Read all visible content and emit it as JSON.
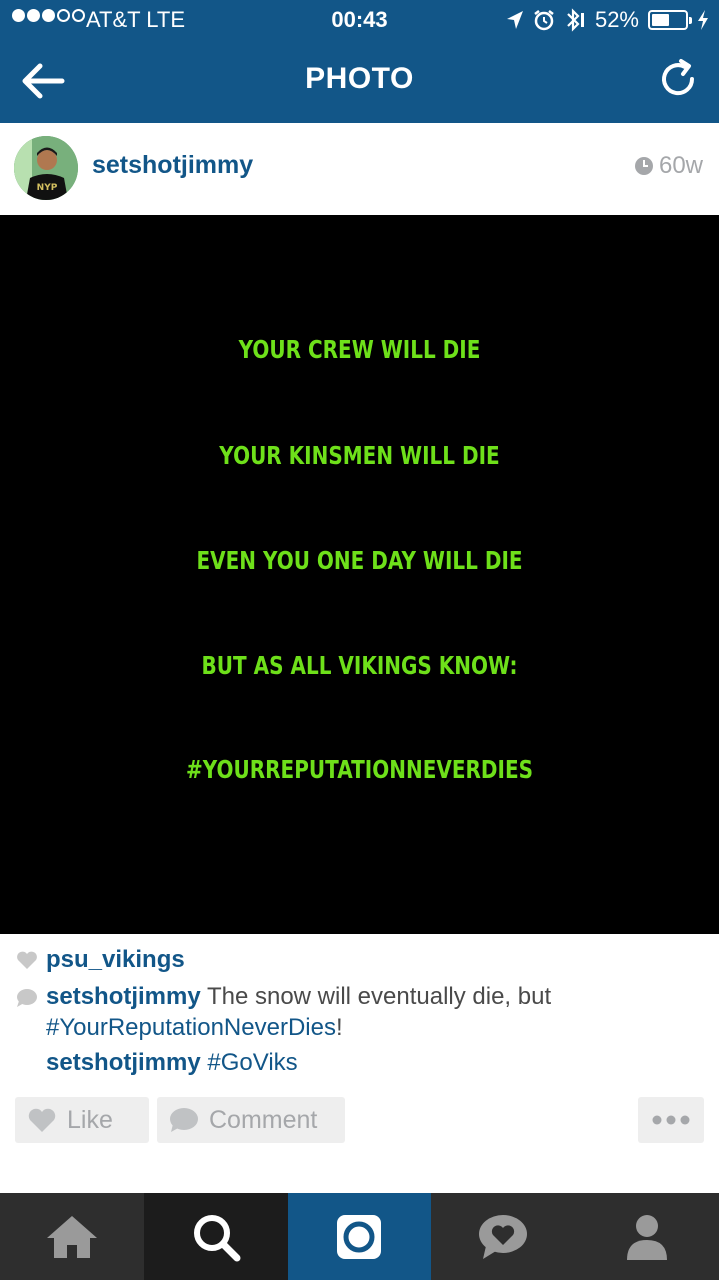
{
  "status_bar": {
    "carrier": "AT&T  LTE",
    "time": "00:43",
    "battery": "52%",
    "battery_level": 0.52
  },
  "nav": {
    "title": "PHOTO"
  },
  "post": {
    "username": "setshotjimmy",
    "age": "60w",
    "photo_text": [
      "YOUR CREW WILL DIE",
      "YOUR KINSMEN WILL DIE",
      "EVEN YOU ONE DAY WILL DIE",
      "BUT AS ALL VIKINGS KNOW:",
      "#YOURREPUTATIONNEVERDIES"
    ],
    "likes": "psu_vikings",
    "caption_user": "setshotjimmy",
    "caption_text": " The snow will eventually die, but",
    "caption_hashtag": "#YourReputationNeverDies",
    "caption_end": "!",
    "comment_user": "setshotjimmy",
    "comment_hashtag": " #GoViks"
  },
  "actions": {
    "like_label": "Like",
    "comment_label": "Comment"
  },
  "colors": {
    "brand_blue": "#125688",
    "photo_text_green": "#6ee01a",
    "tabbar": "#2e2e2e"
  },
  "tabs": [
    "home-icon",
    "search-icon",
    "camera-icon",
    "activity-icon",
    "profile-icon"
  ]
}
